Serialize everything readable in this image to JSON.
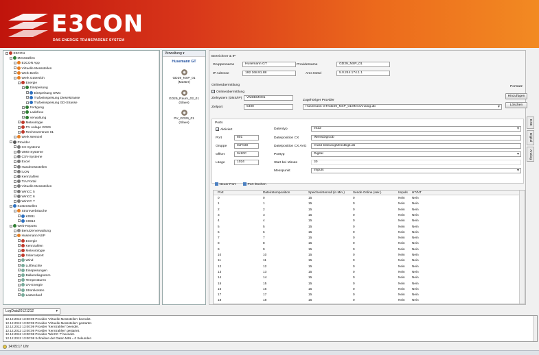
{
  "header": {
    "title": "E3CON",
    "subtitle": "DAS ENERGIE TRANSPARENZ SYSTEM"
  },
  "tree": [
    {
      "l": "E3CON",
      "d": 0,
      "c": "#c0392b"
    },
    {
      "l": "Messstellen",
      "d": 1,
      "c": "#2e7d32"
    },
    {
      "l": "E3CON App",
      "d": 2,
      "c": "#e67e22"
    },
    {
      "l": "Virtuelle Messstellen",
      "d": 2,
      "c": "#e67e22"
    },
    {
      "l": "Werk Berlin",
      "d": 2,
      "c": "#e67e22"
    },
    {
      "l": "Werk Gütersloh",
      "d": 2,
      "c": "#e67e22"
    },
    {
      "l": "Energie",
      "d": 3,
      "c": "#c0392b"
    },
    {
      "l": "Einspeisung",
      "d": 4,
      "c": "#2e7d32"
    },
    {
      "l": "Einspeisung SWG",
      "d": 5,
      "c": "#2c6fbf"
    },
    {
      "l": "Trafoeinspeisung Dieselstrasse",
      "d": 5,
      "c": "#2c6fbf"
    },
    {
      "l": "Trafoeinspeisung GD-Strasse",
      "d": 5,
      "c": "#2c6fbf"
    },
    {
      "l": "Fertigung",
      "d": 4,
      "c": "#2e7d32"
    },
    {
      "l": "Ladefoox",
      "d": 4,
      "c": "#2e7d32"
    },
    {
      "l": "Verwaltung",
      "d": 4,
      "c": "#2e7d32"
    },
    {
      "l": "Meteorlogie",
      "d": 3,
      "c": "#c0392b"
    },
    {
      "l": "PV Anlage GD29",
      "d": 3,
      "c": "#c0392b"
    },
    {
      "l": "Rechenzentrum 01",
      "d": 3,
      "c": "#c0392b"
    },
    {
      "l": "Werk Wemzel",
      "d": 2,
      "c": "#e67e22"
    },
    {
      "l": "Provider",
      "d": 1,
      "c": "#555"
    },
    {
      "l": "CX-Systeme",
      "d": 2,
      "c": "#777"
    },
    {
      "l": "UMG-Systeme",
      "d": 2,
      "c": "#777"
    },
    {
      "l": "CSV-Systeme",
      "d": 2,
      "c": "#777"
    },
    {
      "l": "Excel",
      "d": 2,
      "c": "#777"
    },
    {
      "l": "Handmessstellen",
      "d": 2,
      "c": "#777"
    },
    {
      "l": "iLON",
      "d": 2,
      "c": "#777"
    },
    {
      "l": "Kennzahlen",
      "d": 2,
      "c": "#777"
    },
    {
      "l": "TIA Portal",
      "d": 2,
      "c": "#777"
    },
    {
      "l": "Virtuelle Messstellen",
      "d": 2,
      "c": "#777"
    },
    {
      "l": "WinCC 5",
      "d": 2,
      "c": "#777"
    },
    {
      "l": "WinCC 6",
      "d": 2,
      "c": "#777"
    },
    {
      "l": "WinCC 7",
      "d": 2,
      "c": "#777"
    },
    {
      "l": "Kostenstellen",
      "d": 1,
      "c": "#2c6fbf"
    },
    {
      "l": "Stromverbräuche",
      "d": 2,
      "c": "#e67e22"
    },
    {
      "l": "K0811",
      "d": 3,
      "c": "#2c6fbf"
    },
    {
      "l": "K0812",
      "d": 3,
      "c": "#2c6fbf"
    },
    {
      "l": "Web-Reports",
      "d": 1,
      "c": "#2e7d32"
    },
    {
      "l": "Benutzerverwaltung",
      "d": 2,
      "c": "#888"
    },
    {
      "l": "Husemann NSP",
      "d": 2,
      "c": "#e67e22"
    },
    {
      "l": "Energie",
      "d": 3,
      "c": "#c0392b"
    },
    {
      "l": "Kennzahlen",
      "d": 3,
      "c": "#c0392b"
    },
    {
      "l": "Meteorologie",
      "d": 3,
      "c": "#c0392b"
    },
    {
      "l": "Solarcarport",
      "d": 3,
      "c": "#c0392b"
    },
    {
      "l": "Wind",
      "d": 3,
      "c": "#7a9"
    },
    {
      "l": "Luftfeuchte",
      "d": 3,
      "c": "#7a9"
    },
    {
      "l": "Einspeisungen",
      "d": 3,
      "c": "#7a9"
    },
    {
      "l": "Balkendiagramm",
      "d": 3,
      "c": "#7a9"
    },
    {
      "l": "Temperaturen",
      "d": 3,
      "c": "#7a9"
    },
    {
      "l": "UV-Energie",
      "d": 3,
      "c": "#7a9"
    },
    {
      "l": "Stromkosten",
      "d": 3,
      "c": "#7a9"
    },
    {
      "l": "Lastverlauf",
      "d": 3,
      "c": "#7a9"
    }
  ],
  "devices": {
    "toolbar": "Verwaltung ▾",
    "title": "Husemann GT",
    "items": [
      {
        "name": "GD29_NSP_01",
        "role": "(Master)"
      },
      {
        "name": "GD29_Raum_02_01",
        "role": "(Slave)"
      },
      {
        "name": "PV_GD29_01",
        "role": "(Slave)"
      }
    ]
  },
  "ip": {
    "section": "Bezeichner & IP",
    "group_label": "Gruppenname",
    "group_value": "Husemann GT",
    "provider_label": "Providername",
    "provider_value": "GD29_NSP_01",
    "ip_label": "IP Adresse",
    "ip_value": "192.168.91.88",
    "ams_label": "Ams NetId",
    "ams_value": "5.0.244.174.1.1"
  },
  "online": {
    "section": "Onlineübermittlung",
    "check_label": "Onlineübermittlung",
    "target_label": "Zielsystem (DNS/IP)",
    "target_value": "VMDEMO01",
    "port_label": "Zielport",
    "port_value": "5400",
    "provider_label": "Zugehöriger Provider",
    "provider_value": "Husemann GT/GD29_NSP_01/MessAnalog.db",
    "portsatz": "Portsatz",
    "add_btn": "Hinzufügen",
    "del_btn": "Löschen"
  },
  "ports": {
    "section": "Ports",
    "active_label": "Aktiviert",
    "port_label": "Port",
    "port_value": "801",
    "gruppe_label": "Gruppe",
    "gruppe_value": "0xF030",
    "offset_label": "Offset",
    "offset_value": "0x10C",
    "laenge_label": "Länge",
    "laenge_value": "1024",
    "datentyp_label": "Datentyp",
    "datentyp_value": "Int32",
    "cx_label": "Dateiposition CX",
    "cx_value": "/MessDigit.db",
    "cxavg_label": "Dateiposition CX AVG",
    "cxavg_value": "/Hard Disk/avgMessDigit.db",
    "porttyp_label": "Porttyp",
    "porttyp_value": "Digital",
    "start_label": "Start bei Minute",
    "start_value": "30",
    "messpunkt_label": "Messpunkt",
    "messpunkt_value": "Impuls",
    "new_btn": "Neuer Port",
    "del_btn": "Port löschen"
  },
  "grid": {
    "headers": [
      "Port",
      "Dateiratompoaition",
      "Speicherintervall (in Min.)",
      "Sende Online (sek.)",
      "Impuls",
      "HT/NT"
    ],
    "rows": [
      [
        "0",
        "0",
        "15",
        "0",
        "Nein",
        "Nein"
      ],
      [
        "1",
        "1",
        "15",
        "0",
        "Nein",
        "Nein"
      ],
      [
        "2",
        "2",
        "15",
        "0",
        "Nein",
        "Nein"
      ],
      [
        "3",
        "3",
        "15",
        "0",
        "Nein",
        "Nein"
      ],
      [
        "4",
        "4",
        "15",
        "0",
        "Nein",
        "Nein"
      ],
      [
        "5",
        "5",
        "15",
        "0",
        "Nein",
        "Nein"
      ],
      [
        "6",
        "6",
        "15",
        "0",
        "Nein",
        "Nein"
      ],
      [
        "7",
        "7",
        "15",
        "0",
        "Nein",
        "Nein"
      ],
      [
        "8",
        "8",
        "15",
        "0",
        "Nein",
        "Nein"
      ],
      [
        "9",
        "9",
        "15",
        "0",
        "Nein",
        "Nein"
      ],
      [
        "10",
        "10",
        "15",
        "0",
        "Nein",
        "Nein"
      ],
      [
        "11",
        "11",
        "15",
        "0",
        "Nein",
        "Nein"
      ],
      [
        "12",
        "12",
        "15",
        "0",
        "Nein",
        "Nein"
      ],
      [
        "13",
        "13",
        "15",
        "0",
        "Nein",
        "Nein"
      ],
      [
        "14",
        "14",
        "15",
        "0",
        "Nein",
        "Nein"
      ],
      [
        "15",
        "15",
        "15",
        "0",
        "Nein",
        "Nein"
      ],
      [
        "16",
        "16",
        "15",
        "0",
        "Nein",
        "Nein"
      ],
      [
        "17",
        "17",
        "15",
        "0",
        "Nein",
        "Nein"
      ],
      [
        "18",
        "18",
        "15",
        "0",
        "Nein",
        "Nein"
      ]
    ]
  },
  "sidetabs": [
    "EXE",
    "Digital",
    "Analog"
  ],
  "log": {
    "tab": "LogData20121212",
    "lines": [
      "12.12.2012 13:00:09 Provider 'Virtuelle Messstellen' beendet.",
      "12.12.2012 13:00:09 Provider 'Virtuelle Messstellen' gestartet.",
      "12.12.2012 13:00:09 Provider 'Kennzahlen' beendet.",
      "12.12.2012 13:00:09 Provider 'Kennzahlen' gestartet.",
      "12.12.2012 13:00:08 Provider 'WinCC 7' beendet.",
      "12.12.2012 13:00:08 Schreiben der Daten MIN = 0 Sekunden"
    ]
  },
  "status": {
    "time": "14:05:17 Uhr"
  }
}
